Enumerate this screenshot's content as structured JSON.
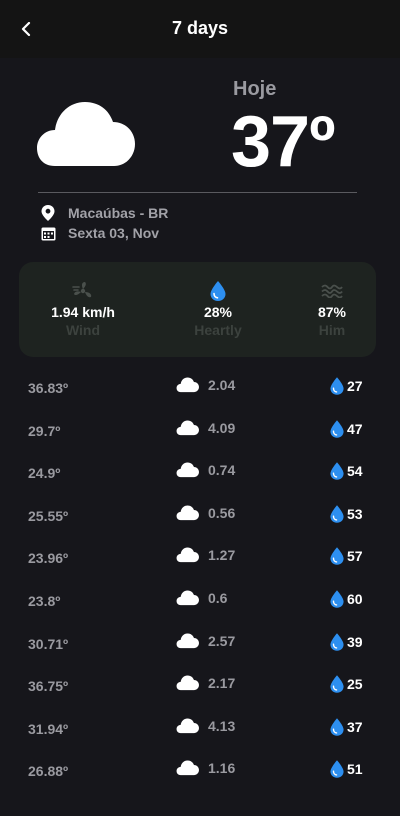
{
  "header": {
    "title": "7 days",
    "back_icon": "chevron-left-icon"
  },
  "today": {
    "label": "Hoje",
    "temperature": "37º",
    "location": "Macaúbas - BR",
    "date": "Sexta 03, Nov",
    "weather_icon": "cloud-icon"
  },
  "stats": {
    "wind": {
      "value": "1.94 km/h",
      "label": "Wind",
      "icon": "wind-icon"
    },
    "rain": {
      "value": "28%",
      "label": "Heartly",
      "icon": "drop-icon"
    },
    "humidity": {
      "value": "87%",
      "label": "Him",
      "icon": "waves-icon"
    }
  },
  "colors": {
    "accent": "#2d8ff0",
    "background": "#16161b",
    "card": "#1e2320",
    "muted": "#9a9aa0"
  },
  "forecast": [
    {
      "temp": "36.83º",
      "value": "2.04",
      "humidity": "27"
    },
    {
      "temp": "29.7º",
      "value": "4.09",
      "humidity": "47"
    },
    {
      "temp": "24.9º",
      "value": "0.74",
      "humidity": "54"
    },
    {
      "temp": "25.55º",
      "value": "0.56",
      "humidity": "53"
    },
    {
      "temp": "23.96º",
      "value": "1.27",
      "humidity": "57"
    },
    {
      "temp": "23.8º",
      "value": "0.6",
      "humidity": "60"
    },
    {
      "temp": "30.71º",
      "value": "2.57",
      "humidity": "39"
    },
    {
      "temp": "36.75º",
      "value": "2.17",
      "humidity": "25"
    },
    {
      "temp": "31.94º",
      "value": "4.13",
      "humidity": "37"
    },
    {
      "temp": "26.88º",
      "value": "1.16",
      "humidity": "51"
    }
  ]
}
